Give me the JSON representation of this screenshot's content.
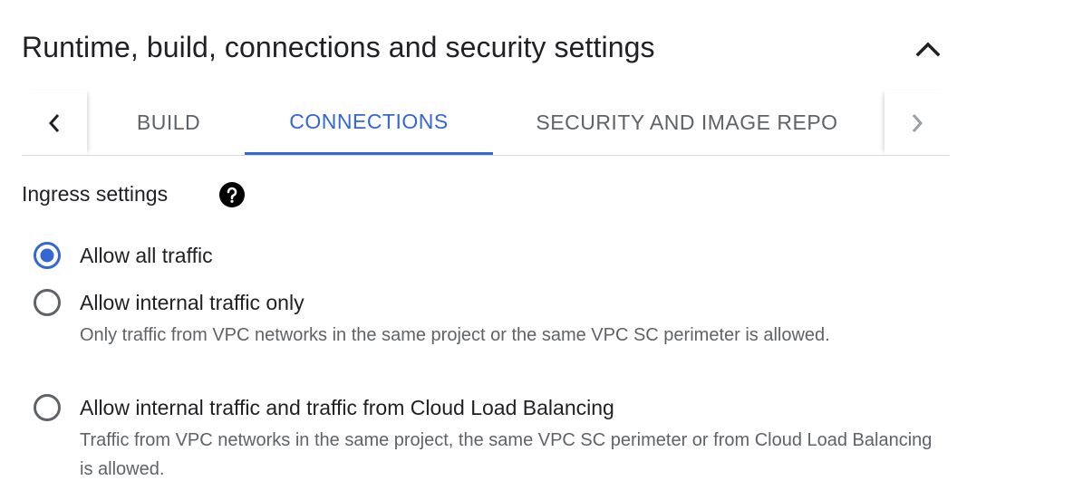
{
  "section": {
    "title": "Runtime, build, connections and security settings",
    "collapse_icon": "chevron-up-icon"
  },
  "tabs": {
    "prev_icon": "chevron-left-icon",
    "next_icon": "chevron-right-icon",
    "items": [
      {
        "label": "BUILD",
        "active": false
      },
      {
        "label": "CONNECTIONS",
        "active": true
      },
      {
        "label": "SECURITY AND IMAGE REPO",
        "active": false
      }
    ],
    "active_color": "#3367d6"
  },
  "ingress": {
    "label": "Ingress settings",
    "help_icon": "help-circle-icon",
    "options": [
      {
        "label": "Allow all traffic",
        "selected": true,
        "description": ""
      },
      {
        "label": "Allow internal traffic only",
        "selected": false,
        "description": "Only traffic from VPC networks in the same project or the same VPC SC perimeter is allowed."
      },
      {
        "label": "Allow internal traffic and traffic from Cloud Load Balancing",
        "selected": false,
        "description": "Traffic from VPC networks in the same project, the same VPC SC perimeter or from Cloud Load Balancing is allowed."
      }
    ],
    "radio_selected_color": "#3367d6"
  }
}
